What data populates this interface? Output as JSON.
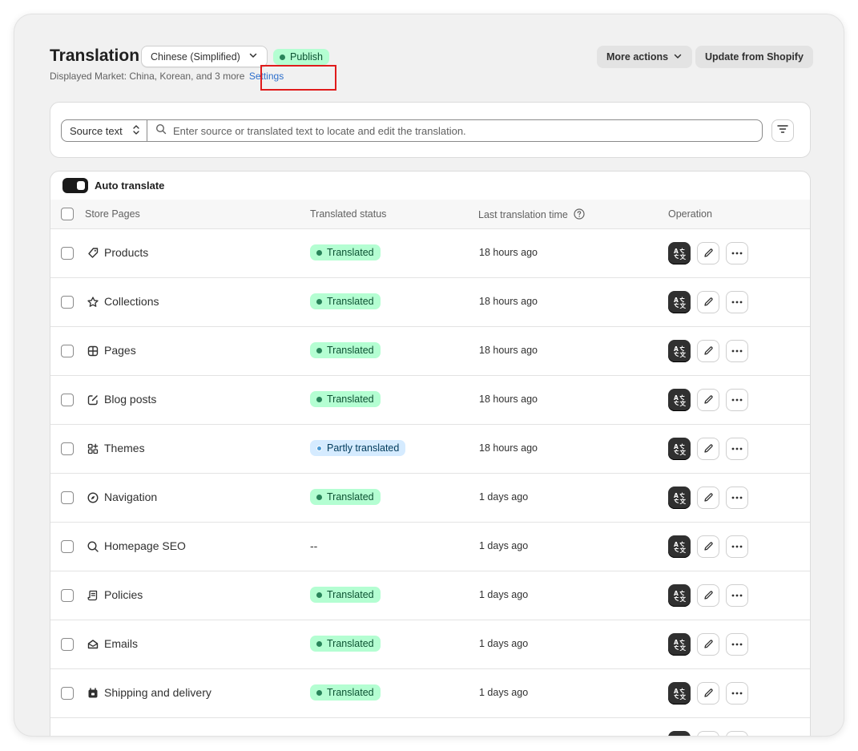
{
  "header": {
    "title": "Translation",
    "language_select": "Chinese (Simplified)",
    "publish_badge": "Publish",
    "market_label": "Displayed Market:",
    "market_value": "China, Korean, and 3 more",
    "settings_link": "Settings",
    "more_actions": "More actions",
    "update_button": "Update from Shopify"
  },
  "search": {
    "source_select": "Source text",
    "placeholder": "Enter source or translated text to locate and edit the translation."
  },
  "table": {
    "auto_translate_label": "Auto translate",
    "columns": {
      "store_pages": "Store Pages",
      "translated_status": "Translated status",
      "last_translation_time": "Last translation time",
      "operation": "Operation"
    },
    "rows": [
      {
        "name": "Products",
        "icon": "tag-icon",
        "status": "Translated",
        "status_type": "translated",
        "time": "18 hours ago"
      },
      {
        "name": "Collections",
        "icon": "star-icon",
        "status": "Translated",
        "status_type": "translated",
        "time": "18 hours ago"
      },
      {
        "name": "Pages",
        "icon": "pages-icon",
        "status": "Translated",
        "status_type": "translated",
        "time": "18 hours ago"
      },
      {
        "name": "Blog posts",
        "icon": "compose-icon",
        "status": "Translated",
        "status_type": "translated",
        "time": "18 hours ago"
      },
      {
        "name": "Themes",
        "icon": "apps-icon",
        "status": "Partly translated",
        "status_type": "partly",
        "time": "18 hours ago"
      },
      {
        "name": "Navigation",
        "icon": "compass-icon",
        "status": "Translated",
        "status_type": "translated",
        "time": "1 days ago"
      },
      {
        "name": "Homepage SEO",
        "icon": "search-icon",
        "status": "--",
        "status_type": "none",
        "time": "1 days ago"
      },
      {
        "name": "Policies",
        "icon": "receipt-icon",
        "status": "Translated",
        "status_type": "translated",
        "time": "1 days ago"
      },
      {
        "name": "Emails",
        "icon": "email-icon",
        "status": "Translated",
        "status_type": "translated",
        "time": "1 days ago"
      },
      {
        "name": "Shipping and delivery",
        "icon": "calendar-icon",
        "status": "Translated",
        "status_type": "translated",
        "time": "1 days ago"
      },
      {
        "name": "",
        "icon": "",
        "status": "",
        "status_type": "none",
        "time": ""
      }
    ]
  },
  "colors": {
    "accent_link": "#2c6ecb",
    "translated_bg": "#b4fed2",
    "partly_bg": "#d5ebff",
    "highlight_border": "#e01b1b"
  }
}
